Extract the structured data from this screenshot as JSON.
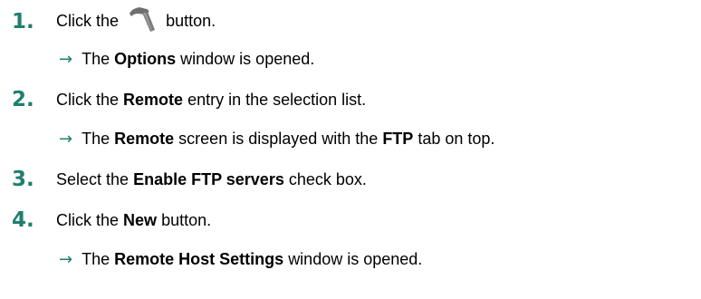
{
  "steps": [
    {
      "number": "1.",
      "pre": "Click the",
      "icon": "hammer-icon",
      "post": "button.",
      "result": {
        "pre": "The",
        "bold": "Options",
        "post": "window is opened."
      }
    },
    {
      "number": "2.",
      "pre": "Click the",
      "bold": "Remote",
      "post": "entry in the selection list.",
      "result": {
        "pre": "The",
        "bold": "Remote",
        "mid": "screen is displayed with the",
        "bold2": "FTP",
        "post": "tab on top."
      }
    },
    {
      "number": "3.",
      "pre": "Select the",
      "bold": "Enable FTP servers",
      "post": "check box."
    },
    {
      "number": "4.",
      "pre": "Click the",
      "bold": "New",
      "post": "button.",
      "result": {
        "pre": "The",
        "bold": "Remote Host Settings",
        "post": "window is opened."
      }
    }
  ],
  "colors": {
    "accent": "#1e7f6e",
    "icon": "#707070"
  }
}
